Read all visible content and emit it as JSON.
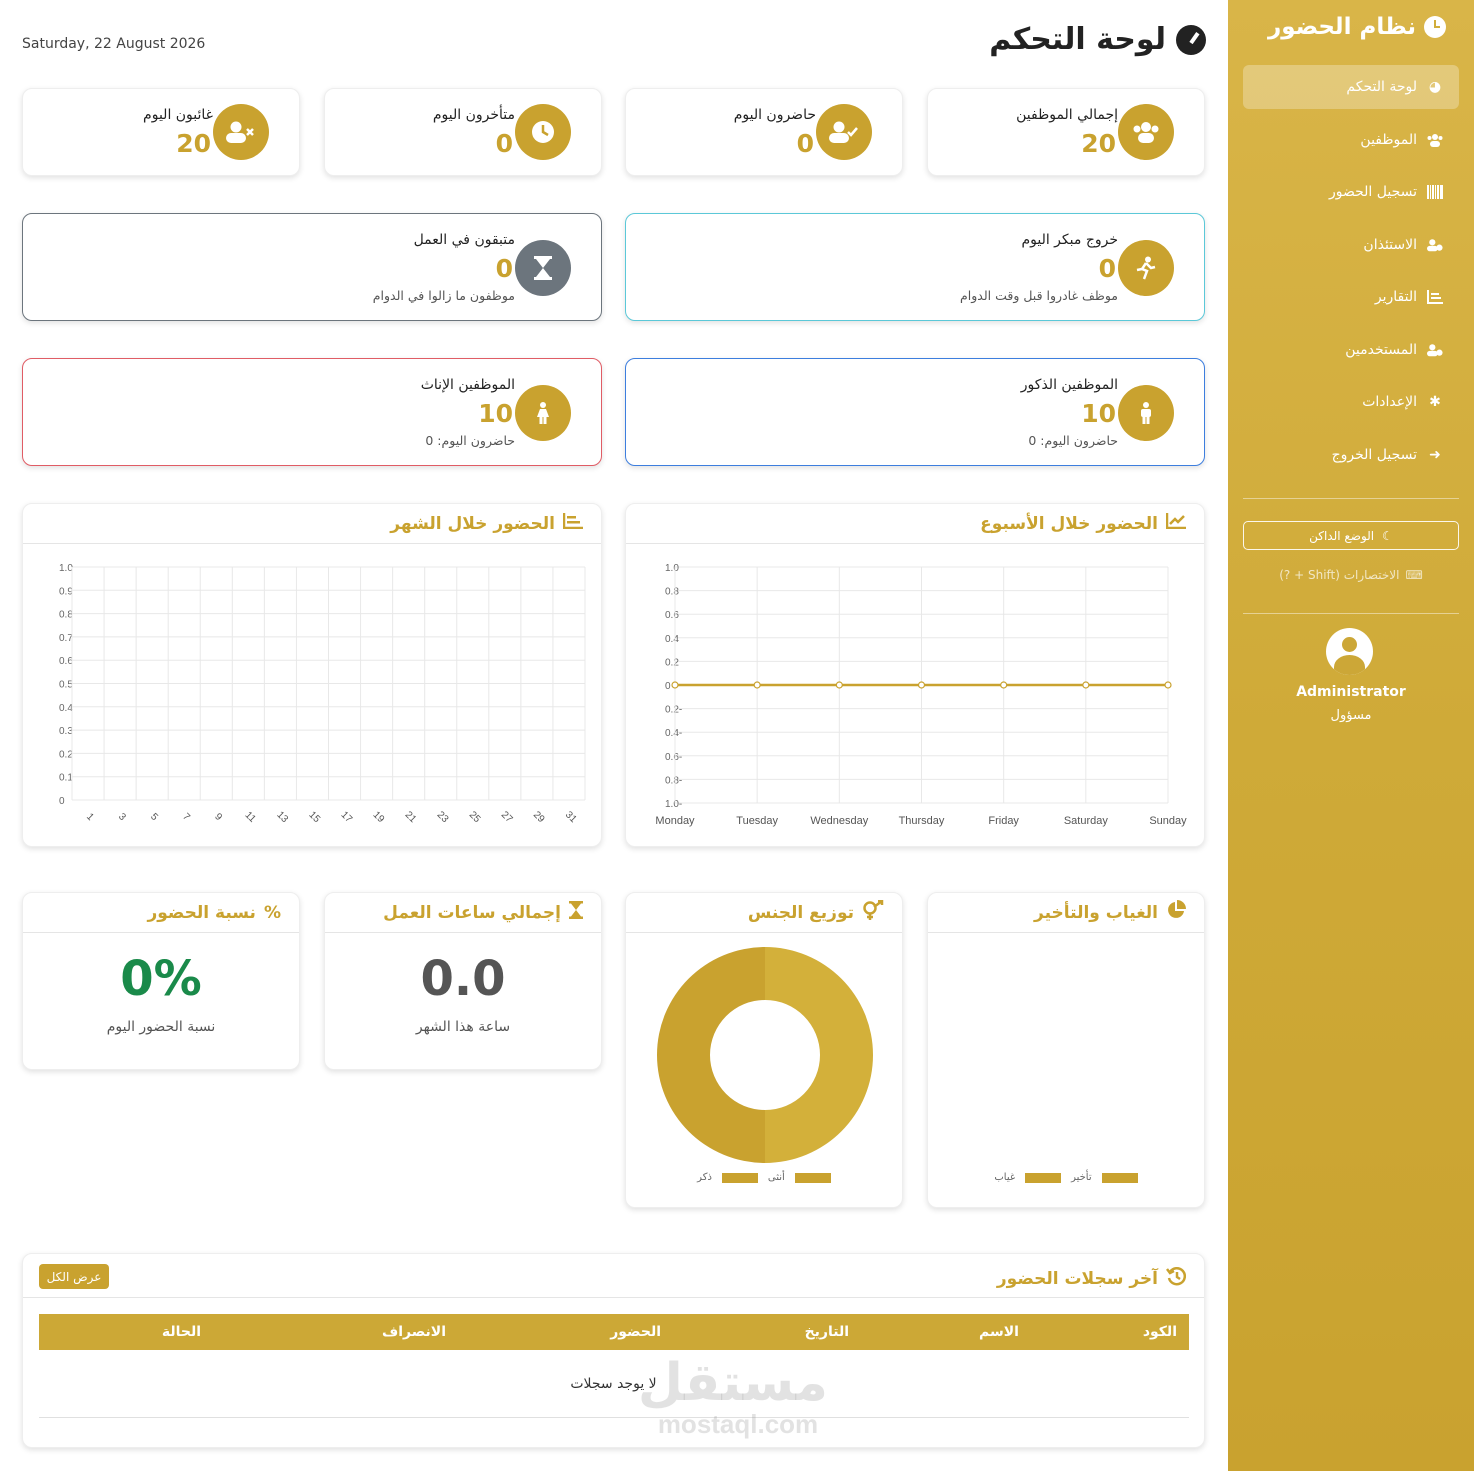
{
  "sidebar": {
    "brand": "نظام الحضور",
    "items": [
      {
        "label": "لوحة التحكم",
        "icon": "gauge-icon"
      },
      {
        "label": "الموظفين",
        "icon": "users-icon"
      },
      {
        "label": "تسجيل الحضور",
        "icon": "barcode-icon"
      },
      {
        "label": "الاستئذان",
        "icon": "user-clock-icon"
      },
      {
        "label": "التقارير",
        "icon": "chart-icon"
      },
      {
        "label": "المستخدمين",
        "icon": "user-cog-icon"
      },
      {
        "label": "الإعدادات",
        "icon": "gear-icon"
      },
      {
        "label": "تسجيل الخروج",
        "icon": "logout-icon"
      }
    ],
    "dark_mode": "الوضع الداكن",
    "shortcuts": "الاختصارات (Shift + ?)",
    "user_name": "Administrator",
    "user_role": "مسؤول"
  },
  "header": {
    "title": "لوحة التحكم",
    "date": "Saturday, 22 August 2026"
  },
  "stats": {
    "total": {
      "label": "إجمالي الموظفين",
      "value": "20"
    },
    "present": {
      "label": "حاضرون اليوم",
      "value": "0"
    },
    "late": {
      "label": "متأخرون اليوم",
      "value": "0"
    },
    "absent": {
      "label": "غائبون اليوم",
      "value": "20"
    }
  },
  "status": {
    "early_leave": {
      "label": "خروج مبكر اليوم",
      "value": "0",
      "sub": "موظف غادروا قبل وقت الدوام"
    },
    "remaining": {
      "label": "متبقون في العمل",
      "value": "0",
      "sub": "موظفون ما زالوا في الدوام"
    },
    "male": {
      "label": "الموظفين الذكور",
      "value": "10",
      "sub": "حاضرون اليوم: 0"
    },
    "female": {
      "label": "الموظفين الإناث",
      "value": "10",
      "sub": "حاضرون اليوم: 0"
    }
  },
  "charts": {
    "weekly_title": "الحضور خلال الأسبوع",
    "monthly_title": "الحضور خلال الشهر",
    "absence_title": "الغياب والتأخير",
    "gender_title": "توزيع الجنس",
    "hours_title": "إجمالي ساعات العمل",
    "rate_title": "نسبة الحضور",
    "hours_value": "0.0",
    "hours_sub": "ساعة هذا الشهر",
    "rate_value": "0%",
    "rate_sub": "نسبة الحضور اليوم",
    "gender_legend": [
      "ذكر",
      "أنثى"
    ],
    "absence_legend": [
      "غياب",
      "تأخير"
    ]
  },
  "chart_data": [
    {
      "type": "line",
      "title": "الحضور خلال الأسبوع",
      "categories": [
        "Monday",
        "Tuesday",
        "Wednesday",
        "Thursday",
        "Friday",
        "Saturday",
        "Sunday"
      ],
      "values": [
        0,
        0,
        0,
        0,
        0,
        0,
        0
      ],
      "ylim": [
        -1.0,
        1.0
      ],
      "yticks": [
        "1.0",
        "0.8",
        "0.6",
        "0.4",
        "0.2",
        "0",
        "-0.2",
        "-0.4",
        "-0.6",
        "-0.8",
        "-1.0"
      ],
      "color": "#c9a22f"
    },
    {
      "type": "bar",
      "title": "الحضور خلال الشهر",
      "categories": [
        "1",
        "3",
        "5",
        "7",
        "9",
        "11",
        "13",
        "15",
        "17",
        "19",
        "21",
        "23",
        "25",
        "27",
        "29",
        "31"
      ],
      "values": [],
      "ylim": [
        0,
        1.0
      ],
      "yticks": [
        "1.0",
        "0.9",
        "0.8",
        "0.7",
        "0.6",
        "0.5",
        "0.4",
        "0.3",
        "0.2",
        "0.1",
        "0"
      ]
    },
    {
      "type": "pie",
      "title": "توزيع الجنس",
      "labels": [
        "ذكر",
        "أنثى"
      ],
      "values": [
        10,
        10
      ],
      "colors": [
        "#c9a22f",
        "#d3b03a"
      ]
    }
  ],
  "records": {
    "title": "آخر سجلات الحضور",
    "view_all": "عرض الكل",
    "columns": [
      "الكود",
      "الاسم",
      "التاريخ",
      "الحضور",
      "الانصراف",
      "الحالة"
    ],
    "empty": "لا يوجد سجلات"
  },
  "watermark": {
    "ar": "مستقل",
    "en": "mostaql.com"
  },
  "colors": {
    "accent": "#c9a22f",
    "success": "#1a8a4a",
    "muted": "#555555"
  }
}
